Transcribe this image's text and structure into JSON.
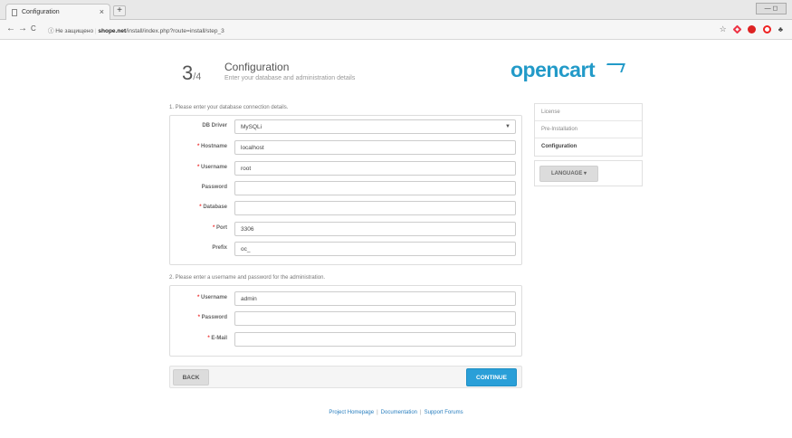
{
  "browser": {
    "tab_title": "Configuration",
    "tab_close": "×",
    "new_tab": "+",
    "window_controls": "— ◻",
    "back": "←",
    "forward": "→",
    "reload": "C",
    "security": "ⓘ Не защищено",
    "url_host": "shope.net",
    "url_path": "/install/index.php?route=install/step_3"
  },
  "header": {
    "step_number": "3",
    "step_total": "/4",
    "title": "Configuration",
    "subtitle": "Enter your database and administration details",
    "logo": "opencart"
  },
  "db_section": {
    "label": "1. Please enter your database connection details.",
    "fields": [
      {
        "label": "DB Driver",
        "required": false,
        "value": "MySQLi",
        "type": "select"
      },
      {
        "label": "Hostname",
        "required": true,
        "value": "localhost"
      },
      {
        "label": "Username",
        "required": true,
        "value": "root"
      },
      {
        "label": "Password",
        "required": false,
        "value": ""
      },
      {
        "label": "Database",
        "required": true,
        "value": ""
      },
      {
        "label": "Port",
        "required": true,
        "value": "3306"
      },
      {
        "label": "Prefix",
        "required": false,
        "value": "oc_"
      }
    ]
  },
  "admin_section": {
    "label": "2. Please enter a username and password for the administration.",
    "fields": [
      {
        "label": "Username",
        "required": true,
        "value": "admin"
      },
      {
        "label": "Password",
        "required": true,
        "value": ""
      },
      {
        "label": "E-Mail",
        "required": true,
        "value": ""
      }
    ]
  },
  "buttons": {
    "back": "BACK",
    "continue": "CONTINUE"
  },
  "sidebar": {
    "items": [
      {
        "label": "License"
      },
      {
        "label": "Pre-Installation"
      },
      {
        "label": "Configuration"
      }
    ],
    "language": "LANGUAGE ▾"
  },
  "footer": {
    "links": [
      "Project Homepage",
      "Documentation",
      "Support Forums"
    ],
    "separator": "|"
  },
  "colors": {
    "accent": "#229ac8",
    "required": "#e33333"
  }
}
